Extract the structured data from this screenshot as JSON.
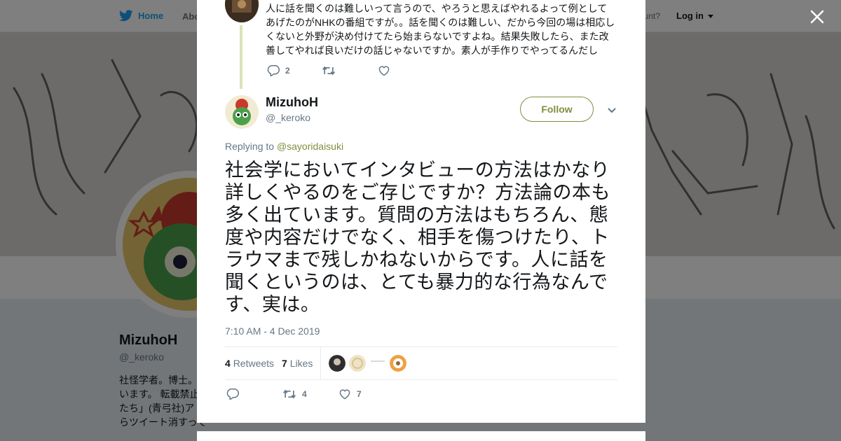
{
  "nav": {
    "home_label": "Home",
    "about_label": "Abo",
    "account_prompt": "ccount?",
    "login_label": "Log in"
  },
  "profile": {
    "name": "MizuhoH",
    "handle": "@_keroko",
    "bio_lines": [
      "社怪学者。博士。",
      "います。 転載禁止",
      "たち」(青弓社)ア",
      "らツイート消すっては。"
    ]
  },
  "parent_tweet": {
    "text": "人に話を聞くのは難しいって言うので、やろうと思えばやれるよって例としてあげたのがNHKの番組ですが。。話を聞くのは難しい、だから今回の場は相応しくないと外野が決め付けてたら始まらないですよね。結果失敗したら、また改善してやれば良いだけの話じゃないですか。素人が手作りでやってるんだし",
    "reply_count": "2",
    "retweet_count": "",
    "like_count": ""
  },
  "tweet": {
    "author_name": "MizuhoH",
    "author_handle": "@_keroko",
    "follow_label": "Follow",
    "replying_prefix": "Replying to",
    "replying_to": "@sayoridaisuki",
    "text": "社会学においてインタビューの方法はかなり詳しくやるのをご存じですか？方法論の本も多く出ています。質問の方法はもちろん、態度や内容だけでなく、相手を傷つけたり、トラウマまで残しかねないからです。人に話を聞くというのは、とても暴力的な行為なんです、実は。",
    "timestamp": "7:10 AM - 4 Dec 2019",
    "retweets_count": "4",
    "retweets_label": "Retweets",
    "likes_count": "7",
    "likes_label": "Likes",
    "action_reply_count": "",
    "action_retweet_count": "4",
    "action_like_count": "7"
  },
  "colors": {
    "accent": "#7e8f3f",
    "twitter_blue": "#1da1f2",
    "text_primary": "#14171a",
    "text_secondary": "#657786",
    "overlay": "rgba(0,0,0,0.5)"
  },
  "icons": [
    "twitter-bird-icon",
    "caret-down-icon",
    "close-icon",
    "reply-icon",
    "retweet-icon",
    "like-icon",
    "chevron-down-icon"
  ]
}
